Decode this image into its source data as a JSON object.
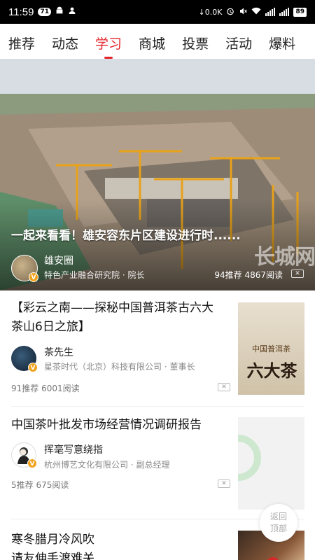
{
  "status": {
    "time": "11:59",
    "notif_count": "71",
    "net_speed": "0.0K",
    "battery": "89"
  },
  "tabs": [
    {
      "label": "推荐"
    },
    {
      "label": "动态"
    },
    {
      "label": "学习",
      "active": true
    },
    {
      "label": "商城"
    },
    {
      "label": "投票"
    },
    {
      "label": "活动"
    },
    {
      "label": "爆料"
    }
  ],
  "hero": {
    "title": "一起来看看！雄安容东片区建设进行时......",
    "author": "雄安圈",
    "author_title": "特色产业融合研究院 · 院长",
    "stats": "94推荐  4867阅读",
    "watermark": "长城网",
    "close": "✕"
  },
  "articles": [
    {
      "title": "【彩云之南——探秘中国普洱茶古六大茶山6日之旅】",
      "author": "茶先生",
      "author_title": "星茶时代（北京）科技有限公司 · 董事长",
      "stats": "91推荐  6001阅读",
      "close": "✕",
      "thumb_text_top": "中国普洱茶",
      "thumb_text_main": "六大茶"
    },
    {
      "title": "中国茶叶批发市场经营情况调研报告",
      "author": "挥毫写意绕指",
      "author_title": "杭州博艺文化有限公司 · 副总经理",
      "stats": "5推荐  675阅读",
      "close": "✕"
    },
    {
      "title": "寒冬腊月冷风吹",
      "title_line2": "请友伸手渡难关"
    }
  ],
  "back_top": {
    "line1": "返回",
    "line2": "顶部"
  },
  "colors": {
    "accent": "#e5252c",
    "badge": "#f0a21b"
  }
}
